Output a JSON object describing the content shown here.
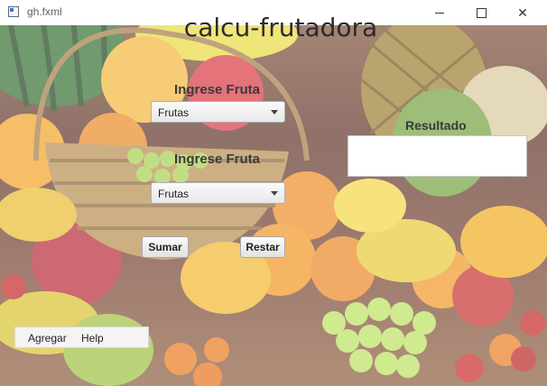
{
  "window": {
    "title": "gh.fxml"
  },
  "header": {
    "title": "calcu-frutadora"
  },
  "form": {
    "fruit1_label": "Ingrese Fruta",
    "fruit1_value": "Frutas",
    "fruit2_label": "Ingrese Fruta",
    "fruit2_value": "Frutas",
    "result_label": "Resultado",
    "result_value": "",
    "add_button": "Sumar",
    "subtract_button": "Restar"
  },
  "menu": {
    "items": [
      "Agregar",
      "Help"
    ]
  },
  "icons": {
    "app": "app-window-icon",
    "minimize": "minimize-icon",
    "maximize": "maximize-icon",
    "close": "close-icon",
    "dropdown": "chevron-down-icon"
  },
  "background": {
    "subject": "fruit basket still life"
  }
}
